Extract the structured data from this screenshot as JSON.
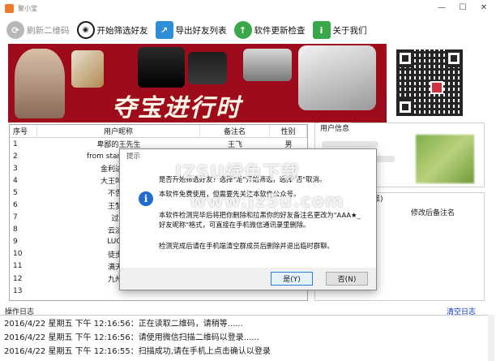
{
  "window": {
    "title": "聚小宝",
    "minimize": "—",
    "maximize": "☐",
    "close": "✕"
  },
  "toolbar": {
    "refresh_qr": "刷新二维码",
    "start_filter": "开始筛选好友",
    "export_list": "导出好友列表",
    "update_check": "软件更新检查",
    "about": "关于我们"
  },
  "banner": {
    "slogan": "夺宝进行时"
  },
  "table": {
    "headers": [
      "序号",
      "用户昵称",
      "备注名",
      "性别"
    ],
    "rows": [
      {
        "no": "1",
        "nick": "卑鄙的王先生",
        "remark": "王飞",
        "gender": "男"
      },
      {
        "no": "2",
        "nick": "from starts to the",
        "remark": "",
        "gender": ""
      },
      {
        "no": "3",
        "nick": "金利达办公",
        "remark": "",
        "gender": ""
      },
      {
        "no": "4",
        "nick": "大王叫我来",
        "remark": "",
        "gender": ""
      },
      {
        "no": "5",
        "nick": "不告诉",
        "remark": "",
        "gender": ""
      },
      {
        "no": "6",
        "nick": "王梦龙",
        "remark": "",
        "gender": ""
      },
      {
        "no": "7",
        "nick": "过去",
        "remark": "",
        "gender": ""
      },
      {
        "no": "8",
        "nick": "云淡风",
        "remark": "",
        "gender": ""
      },
      {
        "no": "9",
        "nick": "LUCKY",
        "remark": "",
        "gender": ""
      },
      {
        "no": "10",
        "nick": "徒步者",
        "remark": "",
        "gender": ""
      },
      {
        "no": "11",
        "nick": "满天流",
        "remark": "",
        "gender": ""
      },
      {
        "no": "12",
        "nick": "九州财",
        "remark": "",
        "gender": ""
      },
      {
        "no": "13",
        "nick": "",
        "remark": "",
        "gender": ""
      }
    ]
  },
  "user_info": {
    "label": "用户信息"
  },
  "blacklist": {
    "label": "拉黑)",
    "column": "修改后备注名"
  },
  "log": {
    "title": "操作日志",
    "clear": "清空日志",
    "lines": [
      "2016/4/22 星期五 下午 12:16:56：正在读取二维码，请稍等......",
      "2016/4/22 星期五 下午 12:16:56：请使用微信扫描二维码以登录......",
      "2016/4/22 星期五 下午 12:16:55：扫描成功,请在手机上点击确认以登录"
    ]
  },
  "dialog": {
    "title": "提示",
    "icon": "info-icon",
    "lines": [
      "是否开始筛选好友？选择\"是\"开始筛选，选择\"否\"取消。",
      "本软件免费使用，但需要先关注本软件公众号。",
      "本软件检测完毕后将把你删除和拉黑你的好友备注名更改为\"AAA★_",
      "好友昵称\"格式，可直接在手机微信通讯录里删除。",
      "检测完成后请在手机端清空群成员后删除并退出临时群聊。"
    ],
    "yes": "是(Y)",
    "no": "否(N)"
  },
  "watermark": {
    "text": "IZSU绿色下载",
    "url": "www.jz5u.com"
  }
}
